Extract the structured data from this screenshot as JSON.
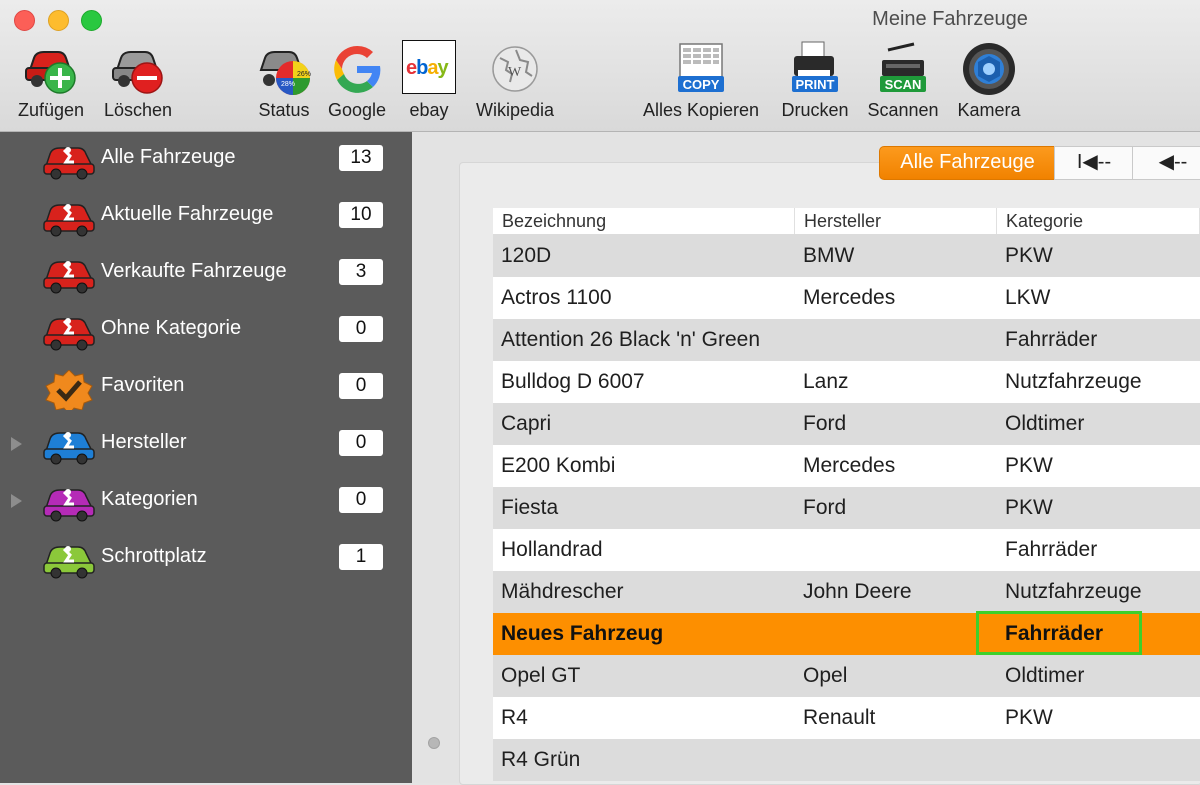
{
  "window": {
    "title": "Meine Fahrzeuge"
  },
  "toolbar": {
    "add_label": "Zufügen",
    "delete_label": "Löschen",
    "status_label": "Status",
    "google_label": "Google",
    "ebay_label": "ebay",
    "wikipedia_label": "Wikipedia",
    "copy_label": "Alles Kopieren",
    "print_label": "Drucken",
    "scan_label": "Scannen",
    "camera_label": "Kamera",
    "copy_icon_text": "COPY",
    "print_icon_text": "PRINT",
    "scan_icon_text": "SCAN",
    "ebay_icon_text": "ebay",
    "google_icon_text": "G",
    "status_pct_a": "28%",
    "status_pct_b": "26%"
  },
  "sidebar": {
    "items": [
      {
        "label": "Alle Fahrzeuge",
        "count": "13",
        "icon": "car-red-icon",
        "color": "#d8221c"
      },
      {
        "label": "Aktuelle Fahrzeuge",
        "count": "10",
        "icon": "car-red-icon",
        "color": "#d8221c"
      },
      {
        "label": "Verkaufte Fahrzeuge",
        "count": "3",
        "icon": "car-red-icon",
        "color": "#d8221c"
      },
      {
        "label": "Ohne Kategorie",
        "count": "0",
        "icon": "car-red-icon",
        "color": "#d8221c"
      },
      {
        "label": "Favoriten",
        "count": "0",
        "icon": "favorite-badge-icon",
        "color": "#f0891d"
      },
      {
        "label": "Hersteller",
        "count": "0",
        "icon": "car-blue-icon",
        "color": "#1e7fd6"
      },
      {
        "label": "Kategorien",
        "count": "0",
        "icon": "car-purple-icon",
        "color": "#b52bb7"
      },
      {
        "label": "Schrottplatz",
        "count": "1",
        "icon": "car-green-icon",
        "color": "#8bc83a"
      }
    ]
  },
  "main": {
    "segment_active": "Alle Fahrzeuge",
    "segment_first": "I◀--",
    "segment_prev": "◀--",
    "columns": [
      "Bezeichnung",
      "Hersteller",
      "Kategorie"
    ],
    "rows": [
      [
        "120D",
        "BMW",
        "PKW"
      ],
      [
        "Actros 1100",
        "Mercedes",
        "LKW"
      ],
      [
        "Attention 26 Black 'n' Green",
        "",
        "Fahrräder"
      ],
      [
        "Bulldog D 6007",
        "Lanz",
        "Nutzfahrzeuge"
      ],
      [
        "Capri",
        "Ford",
        "Oldtimer"
      ],
      [
        "E200 Kombi",
        "Mercedes",
        "PKW"
      ],
      [
        "Fiesta",
        "Ford",
        "PKW"
      ],
      [
        "Hollandrad",
        "",
        "Fahrräder"
      ],
      [
        "Mähdrescher",
        "John Deere",
        "Nutzfahrzeuge"
      ],
      [
        "Neues Fahrzeug",
        "",
        "Fahrräder"
      ],
      [
        "Opel GT",
        "Opel",
        "Oldtimer"
      ],
      [
        "R4",
        "Renault",
        "PKW"
      ],
      [
        "R4 Grün",
        "",
        ""
      ]
    ],
    "selected_row": 9
  },
  "colors": {
    "accent": "#fd8f00",
    "sidebar_bg": "#5b5b5b",
    "focus": "#3ed02b"
  }
}
